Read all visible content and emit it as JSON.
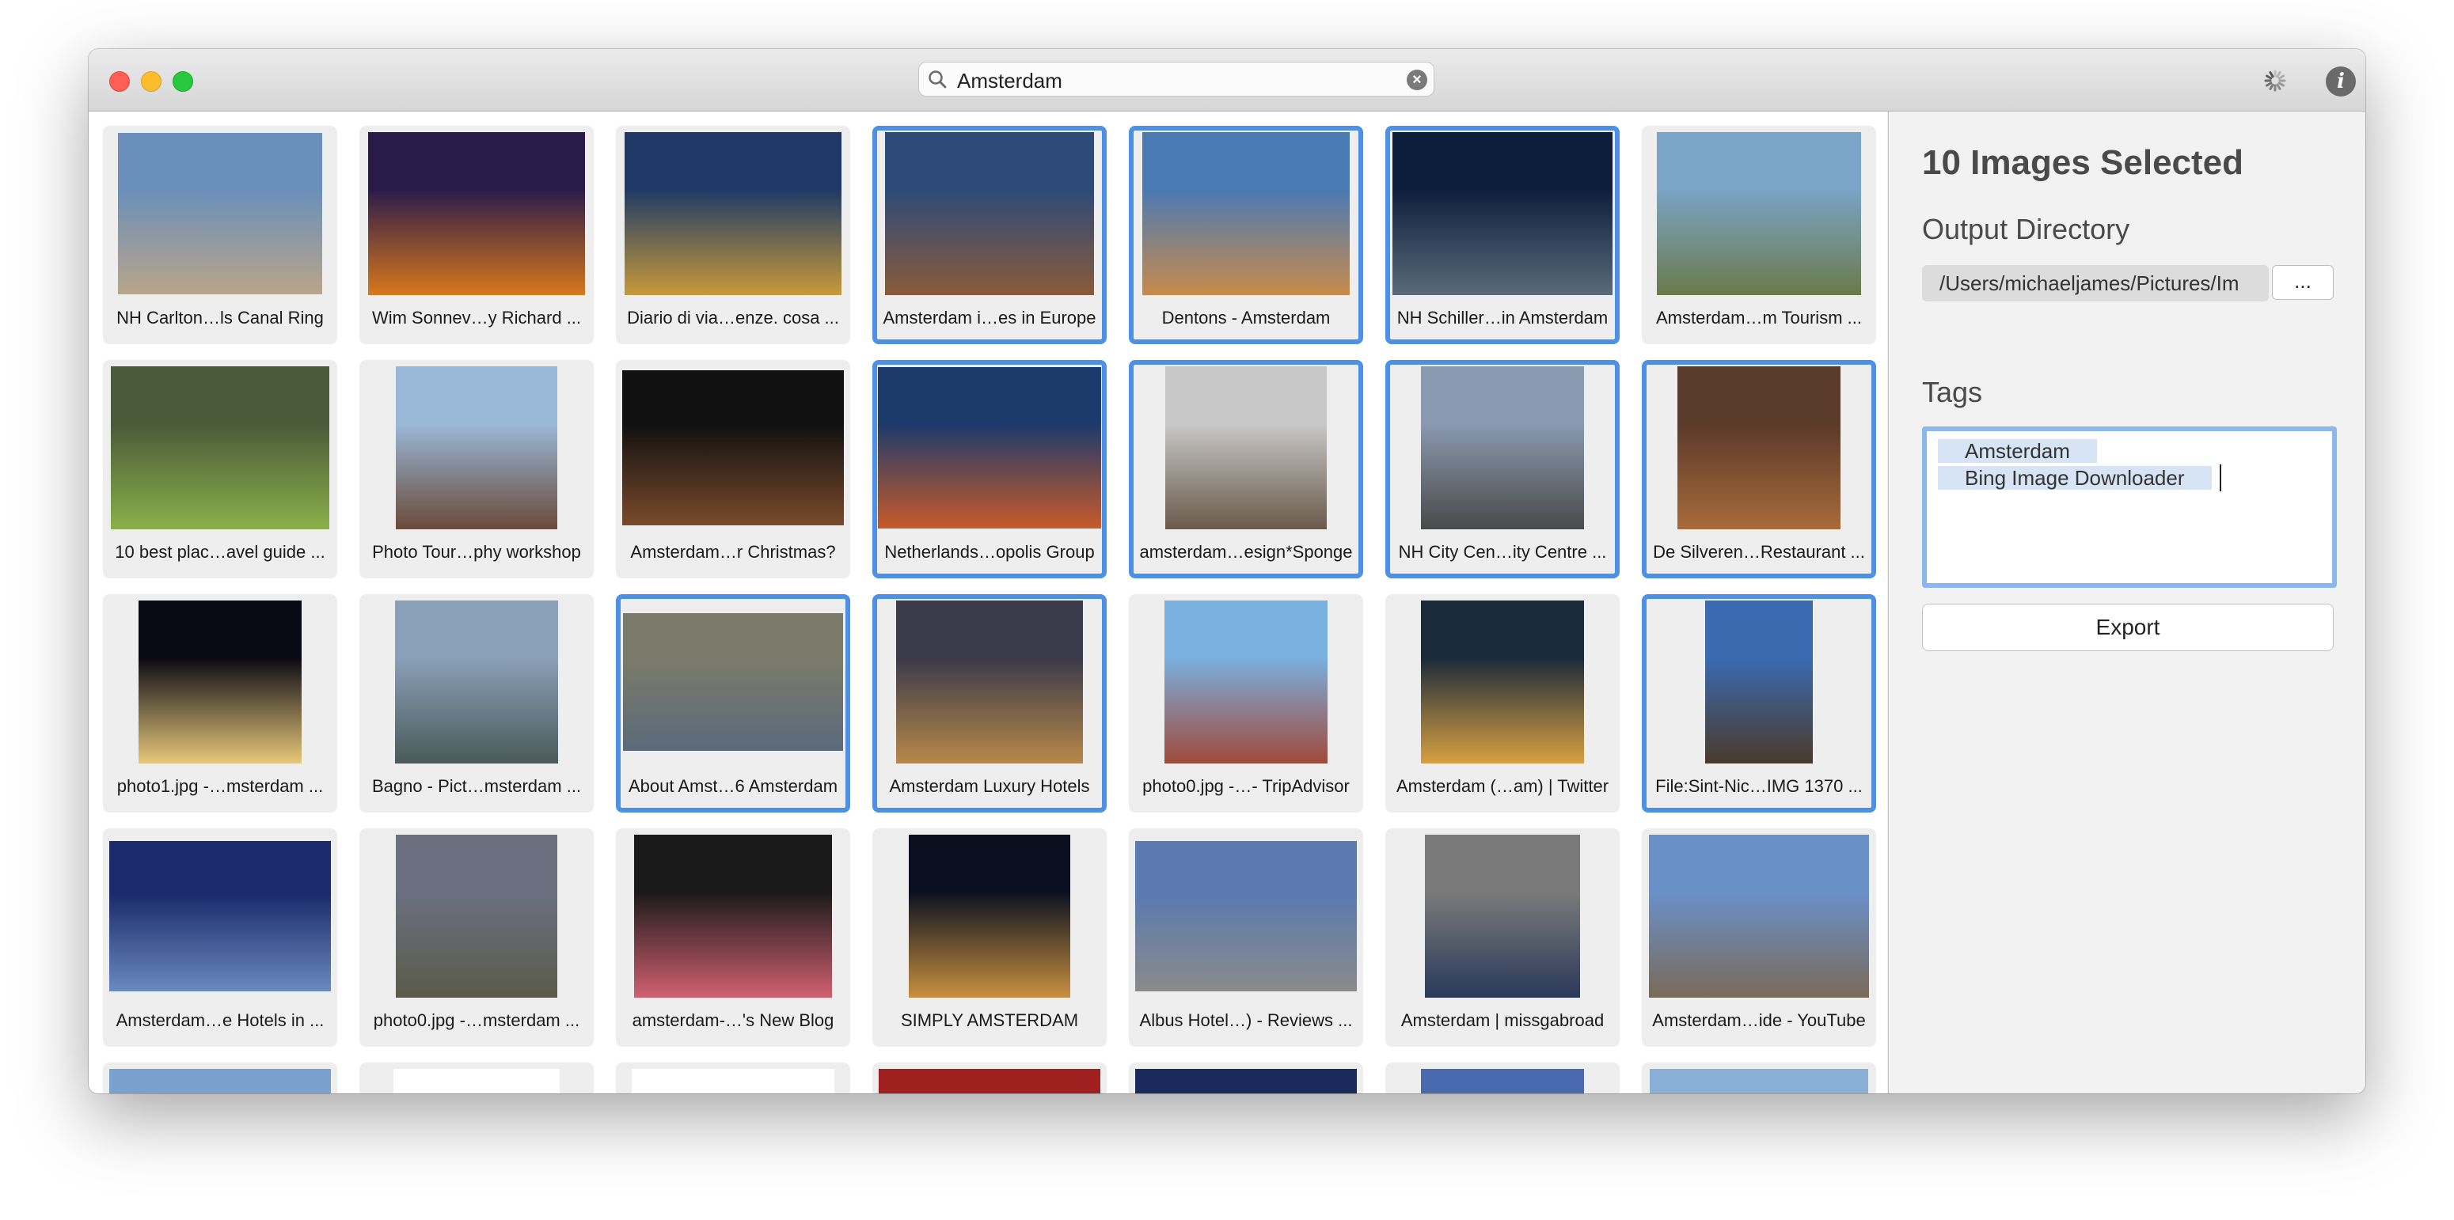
{
  "window": {
    "title_lights": [
      "close",
      "minimize",
      "maximize"
    ]
  },
  "search": {
    "value": "Amsterdam",
    "icon": "search-icon",
    "clear_icon": "clear-icon"
  },
  "toolbar": {
    "spinner_icon": "spinner-icon",
    "info_icon": "info-icon",
    "info_glyph": "i"
  },
  "colors": {
    "selection": "#4c91e6",
    "tile_bg": "#eeeeee",
    "panel_bg": "#f2f2f2"
  },
  "grid": {
    "rows": [
      [
        {
          "caption": "NH Carlton…ls Canal Ring",
          "selected": false,
          "thumb": [
            "#6a8fba",
            "#b9a58a"
          ]
        },
        {
          "caption": "Wim Sonnev…y Richard ...",
          "selected": false,
          "thumb": [
            "#2a1a4a",
            "#d8781c"
          ]
        },
        {
          "caption": "Diario di via…enze. cosa ...",
          "selected": false,
          "thumb": [
            "#1f3a66",
            "#c79a3a"
          ]
        },
        {
          "caption": "Amsterdam i…es in Europe",
          "selected": true,
          "thumb": [
            "#2d4a78",
            "#8a5a3a"
          ]
        },
        {
          "caption": "Dentons - Amsterdam",
          "selected": true,
          "thumb": [
            "#4a7ab4",
            "#c88a4a"
          ]
        },
        {
          "caption": "NH Schiller…in Amsterdam",
          "selected": true,
          "thumb": [
            "#0d1e3c",
            "#5a6a7a"
          ]
        },
        {
          "caption": "Amsterdam…m Tourism ...",
          "selected": false,
          "thumb": [
            "#7aa4c8",
            "#6a7a4a"
          ]
        }
      ],
      [
        {
          "caption": "10 best plac…avel guide ...",
          "selected": false,
          "thumb": [
            "#4a5a3a",
            "#8ab04a"
          ]
        },
        {
          "caption": "Photo Tour…phy workshop",
          "selected": false,
          "thumb": [
            "#9ab8d8",
            "#6a4a3a"
          ]
        },
        {
          "caption": "Amsterdam…r Christmas?",
          "selected": false,
          "thumb": [
            "#111111",
            "#7a4a2a"
          ]
        },
        {
          "caption": "Netherlands…opolis Group",
          "selected": true,
          "thumb": [
            "#1c3a6c",
            "#c85a2a"
          ]
        },
        {
          "caption": "amsterdam…esign*Sponge",
          "selected": true,
          "thumb": [
            "#c8c8c8",
            "#6a5a4a"
          ]
        },
        {
          "caption": "NH City Cen…ity Centre ...",
          "selected": true,
          "thumb": [
            "#8a9ab0",
            "#4a4a4a"
          ]
        },
        {
          "caption": "De Silveren…Restaurant ...",
          "selected": true,
          "thumb": [
            "#5a3a2a",
            "#a86a3a"
          ]
        }
      ],
      [
        {
          "caption": "photo1.jpg -…msterdam ...",
          "selected": false,
          "thumb": [
            "#0a0a14",
            "#e8c87a"
          ]
        },
        {
          "caption": "Bagno - Pict…msterdam ...",
          "selected": false,
          "thumb": [
            "#8aa0b8",
            "#4a5a5a"
          ]
        },
        {
          "caption": "About Amst…6 Amsterdam",
          "selected": true,
          "thumb": [
            "#7a7a6a",
            "#5a6a7a"
          ]
        },
        {
          "caption": "Amsterdam Luxury Hotels",
          "selected": true,
          "thumb": [
            "#3a3a4a",
            "#b8884a"
          ]
        },
        {
          "caption": "photo0.jpg -…- TripAdvisor",
          "selected": false,
          "thumb": [
            "#7ab0e0",
            "#a04a3a"
          ]
        },
        {
          "caption": "Amsterdam (…am) | Twitter",
          "selected": false,
          "thumb": [
            "#1a2a3a",
            "#d8a040"
          ]
        },
        {
          "caption": "File:Sint-Nic…IMG 1370 ...",
          "selected": true,
          "thumb": [
            "#3a6ab0",
            "#4a3a2a"
          ]
        }
      ],
      [
        {
          "caption": "Amsterdam…e Hotels in ...",
          "selected": false,
          "thumb": [
            "#1a2a6a",
            "#6a8ac0"
          ]
        },
        {
          "caption": "photo0.jpg -…msterdam ...",
          "selected": false,
          "thumb": [
            "#6a7080",
            "#5a5a4a"
          ]
        },
        {
          "caption": "amsterdam-…'s New Blog",
          "selected": false,
          "thumb": [
            "#1a1a1a",
            "#d06070"
          ]
        },
        {
          "caption": "SIMPLY AMSTERDAM",
          "selected": false,
          "thumb": [
            "#0a1020",
            "#c89040"
          ]
        },
        {
          "caption": "Albus Hotel…) - Reviews ...",
          "selected": false,
          "thumb": [
            "#5a7ab0",
            "#8a8a8a"
          ]
        },
        {
          "caption": "Amsterdam | missgabroad",
          "selected": false,
          "thumb": [
            "#7a7a7a",
            "#2a3a5a"
          ]
        },
        {
          "caption": "Amsterdam…ide - YouTube",
          "selected": false,
          "thumb": [
            "#6a90c8",
            "#7a6a5a"
          ]
        }
      ],
      [
        {
          "caption": "",
          "selected": false,
          "thumb": [
            "#7aa0d0",
            "#ffffff"
          ]
        },
        {
          "caption": "",
          "selected": false,
          "thumb": [
            "#ffffff",
            "#b0a080"
          ]
        },
        {
          "caption": "",
          "selected": false,
          "thumb": [
            "#ffffff",
            "#dddddd"
          ]
        },
        {
          "caption": "",
          "selected": false,
          "thumb": [
            "#a02020",
            "#e05030"
          ]
        },
        {
          "caption": "",
          "selected": false,
          "thumb": [
            "#1a2a5a",
            "#2a3a6a"
          ]
        },
        {
          "caption": "",
          "selected": false,
          "thumb": [
            "#4a6ab0",
            "#b08040"
          ]
        },
        {
          "caption": "",
          "selected": false,
          "thumb": [
            "#8ab0d8",
            "#a08060"
          ]
        }
      ]
    ]
  },
  "panel": {
    "heading": "10 Images Selected",
    "output_label": "Output Directory",
    "output_path": "/Users/michaeljames/Pictures/Im",
    "browse_label": "...",
    "tags_label": "Tags",
    "tags": [
      "Amsterdam",
      "Bing Image Downloader"
    ],
    "export_label": "Export"
  }
}
